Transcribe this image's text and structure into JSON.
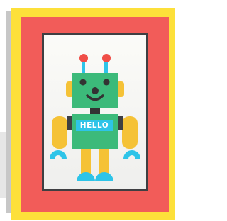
{
  "artwork": {
    "subject": "robot",
    "sign_text": "HELLO"
  },
  "colors": {
    "frame": "#fde03a",
    "mat": "#f25c59",
    "robot_body": "#3cba7a",
    "robot_limbs": "#f5c236",
    "robot_accents": "#2ec4e8",
    "antenna_tips": "#f04e47"
  }
}
